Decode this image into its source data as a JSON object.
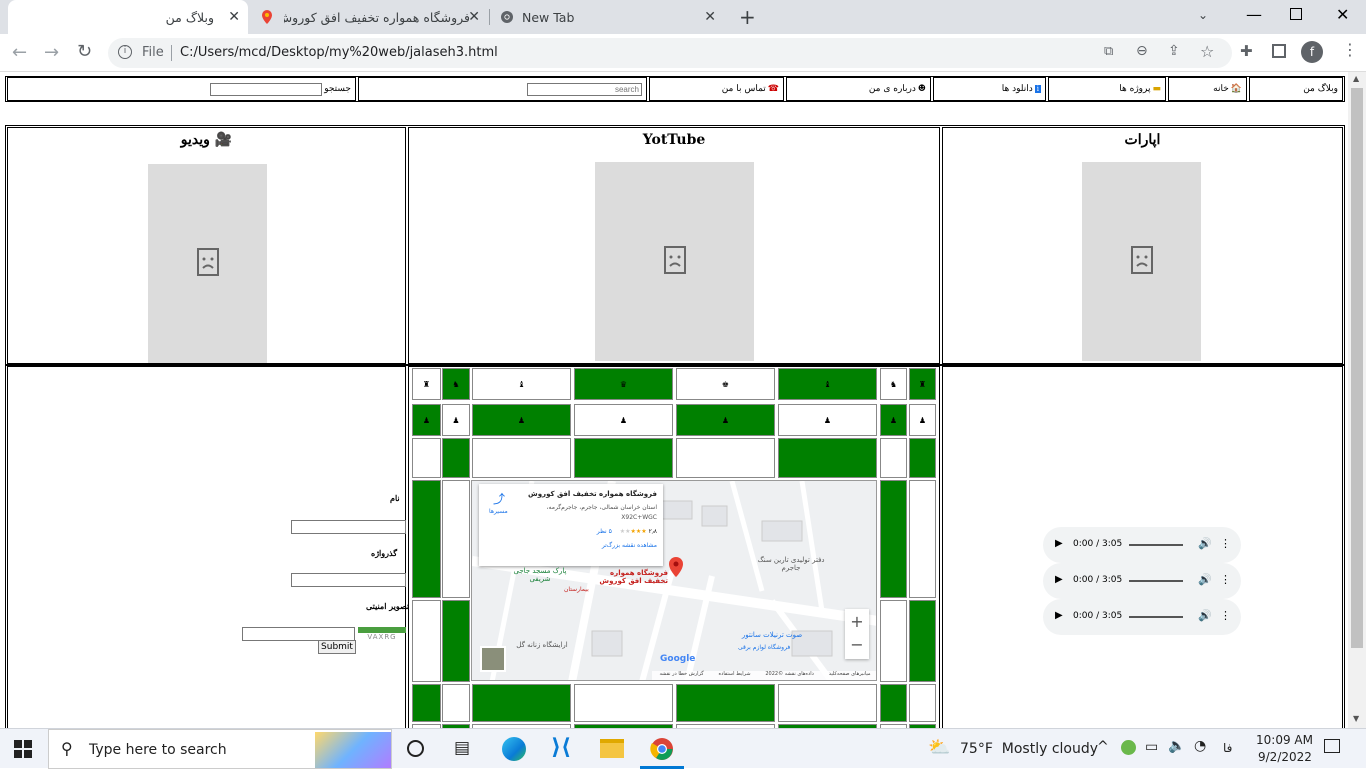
{
  "browser": {
    "tabs": [
      {
        "title": "وبلاگ من"
      },
      {
        "title": "فروشگاه همواره تخفیف افق کوروش"
      },
      {
        "title": "New Tab"
      }
    ],
    "file_label": "File",
    "url": "C:/Users/mcd/Desktop/my%20web/jalaseh3.html",
    "profile_initial": "f"
  },
  "nav": {
    "items": [
      "وبلاگ من",
      "خانه",
      "پروژه ها",
      "دانلود ها",
      "درباره ی من",
      "تماس با من"
    ],
    "search_placeholder": "search",
    "search_label": "جستجو"
  },
  "videos": {
    "aparat": "اپارات",
    "youtube": "YotTube",
    "video": "ویدیو"
  },
  "form": {
    "name_label": "نام",
    "password_label": "گذرواژه",
    "captcha_label": "تصویر امنیتی",
    "submit_label": "Submit"
  },
  "map": {
    "place_name": "فروشگاه همواره تخفیف افق کوروش",
    "address": "استان خراسان شمالی، جاجرم، جاجرم‌گرمه،",
    "plus_code": "X92C+WGC",
    "rating": "۲٫۸",
    "reviews": "۵ نظر",
    "larger_map": "مشاهده نقشه بزرگ‌تر",
    "directions": "مسیرها",
    "labels": [
      "پارک مسجد جاجی شریفی",
      "دفتر تولیدی تارین سنگ جاجرم",
      "صوت ترنیلات سانتور",
      "ارایشگاه زنانه گل",
      "بیمارستان",
      "فروشگاه لوازم برقی"
    ],
    "marker_label": "فروشگاه همواره تخفیف افق کوروش",
    "footer": [
      "میانبرهای صفحه‌کلید",
      "داده‌های نقشه ©2022",
      "شرایط استفاده",
      "گزارش خطا در نقشه"
    ],
    "google": "Google"
  },
  "audio": {
    "players": [
      {
        "time": "0:00 / 3:05"
      },
      {
        "time": "0:00 / 3:05"
      },
      {
        "time": "0:00 / 3:05"
      }
    ]
  },
  "taskbar": {
    "search_placeholder": "Type here to search",
    "weather": "75°F  Mostly cloudy",
    "lang": "فا",
    "time": "10:09 AM",
    "date": "9/2/2022"
  },
  "colors": {
    "chess_green": "#008000",
    "tab_bar": "#dee1e6",
    "taskbar": "#f0f3f9"
  }
}
